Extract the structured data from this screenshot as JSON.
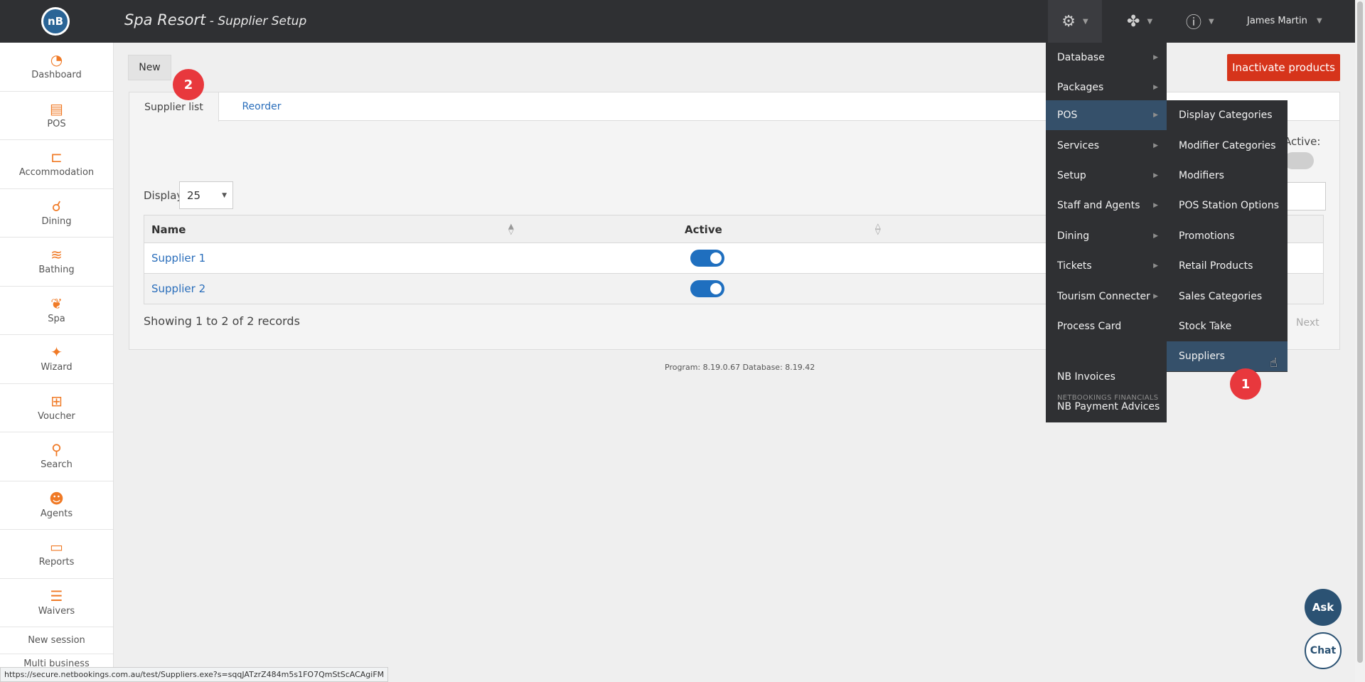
{
  "header": {
    "logo_text": "nB",
    "title": "Spa Resort",
    "subtitle": " - Supplier Setup",
    "settings_icon": "gears-icon",
    "tools_icon": "puzzle-icon",
    "help_icon": "help-icon",
    "user_name": "James Martin"
  },
  "sidebar": {
    "items": [
      {
        "label": "Dashboard",
        "icon": "dashboard-icon",
        "glyph": "◔"
      },
      {
        "label": "POS",
        "icon": "register-icon",
        "glyph": "▤"
      },
      {
        "label": "Accommodation",
        "icon": "bed-icon",
        "glyph": "⊏"
      },
      {
        "label": "Dining",
        "icon": "dining-icon",
        "glyph": "⚲"
      },
      {
        "label": "Bathing",
        "icon": "waves-icon",
        "glyph": "≋"
      },
      {
        "label": "Spa",
        "icon": "lotus-icon",
        "glyph": "❦"
      },
      {
        "label": "Wizard",
        "icon": "wand-icon",
        "glyph": "✦"
      },
      {
        "label": "Voucher",
        "icon": "gift-icon",
        "glyph": "⊞"
      },
      {
        "label": "Search",
        "icon": "search-icon",
        "glyph": "⚲"
      },
      {
        "label": "Agents",
        "icon": "agents-icon",
        "glyph": "☻"
      },
      {
        "label": "Reports",
        "icon": "report-icon",
        "glyph": "▭"
      },
      {
        "label": "Waivers",
        "icon": "checklist-icon",
        "glyph": "☰"
      }
    ],
    "new_session": "New session",
    "multi_business": "Multi business"
  },
  "toolbar": {
    "new_label": "New",
    "inactivate_label": "Inactivate products"
  },
  "tabs": [
    {
      "label": "Supplier list"
    },
    {
      "label": "Reorder"
    }
  ],
  "list": {
    "display_label": "Display",
    "display_value": "25",
    "active_filter_label": "Active:",
    "columns": [
      "Name",
      "Active"
    ],
    "rows": [
      {
        "name": "Supplier 1",
        "active": true
      },
      {
        "name": "Supplier 2",
        "active": true
      }
    ],
    "showing_text": "Showing 1 to 2 of 2 records",
    "next_label": "Next"
  },
  "version_text": "Program: 8.19.0.67 Database: 8.19.42",
  "menu": {
    "items": [
      {
        "label": "Database",
        "has_sub": true
      },
      {
        "label": "Packages",
        "has_sub": true
      },
      {
        "label": "POS",
        "has_sub": true,
        "highlighted": true
      },
      {
        "label": "Services",
        "has_sub": true
      },
      {
        "label": "Setup",
        "has_sub": true
      },
      {
        "label": "Staff and Agents",
        "has_sub": true
      },
      {
        "label": "Dining",
        "has_sub": true
      },
      {
        "label": "Tickets",
        "has_sub": true
      },
      {
        "label": "Tourism Connecter",
        "has_sub": true
      },
      {
        "label": "Process Card",
        "has_sub": false
      }
    ],
    "section_label": "NETBOOKINGS FINANCIALS",
    "financial_items": [
      {
        "label": "NB Invoices"
      },
      {
        "label": "NB Payment Advices"
      }
    ]
  },
  "pos_submenu": {
    "items": [
      {
        "label": "Display Categories"
      },
      {
        "label": "Modifier Categories"
      },
      {
        "label": "Modifiers"
      },
      {
        "label": "POS Station Options"
      },
      {
        "label": "Promotions"
      },
      {
        "label": "Retail Products"
      },
      {
        "label": "Sales Categories"
      },
      {
        "label": "Stock Take"
      },
      {
        "label": "Suppliers",
        "highlighted": true
      }
    ]
  },
  "badges": {
    "first": "1",
    "second": "2"
  },
  "help_widgets": {
    "ask": "Ask",
    "chat": "Chat"
  },
  "status_url": "https://secure.netbookings.com.au/test/Suppliers.exe?s=sqqJATzrZ484m5s1FO7QmStScACAgiFM",
  "colors": {
    "topbar": "#2f3033",
    "accent_orange": "#f07a26",
    "danger": "#d6341b",
    "link": "#2a6ebb",
    "toggle_on": "#1f6fbf",
    "menu_highlight": "#35506a",
    "badge": "#e8383d"
  }
}
